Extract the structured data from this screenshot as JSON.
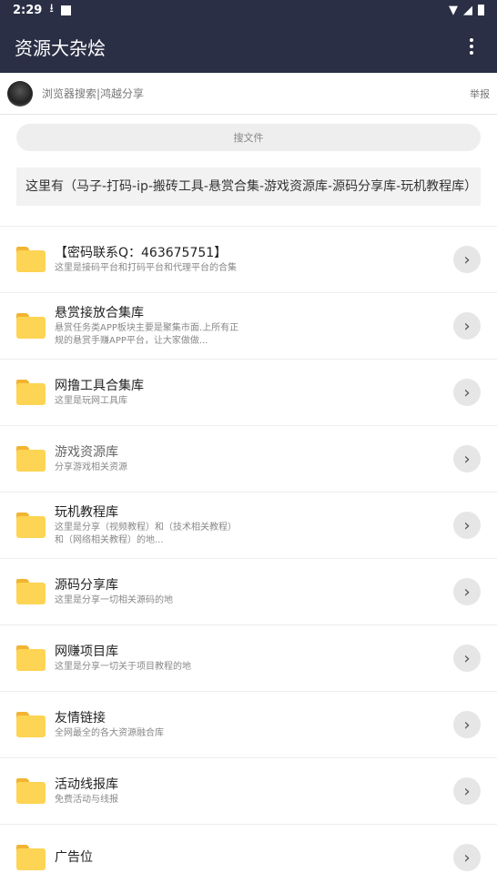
{
  "status": {
    "time": "2:29"
  },
  "appbar": {
    "title": "资源大杂烩"
  },
  "user": {
    "text": "浏览器搜索|鸿越分享",
    "report": "举报"
  },
  "search": {
    "label": "搜文件"
  },
  "description": "这里有（马子-打码-ip-搬砖工具-悬赏合集-游戏资源库-源码分享库-玩机教程库）",
  "items": [
    {
      "name": "【密码联系Q：463675751】",
      "sub": "这里是接码平台和打码平台和代理平台的合集",
      "sub2": ""
    },
    {
      "name": "悬赏接放合集库",
      "sub": "悬赏任务类APP板块主要是聚集市面.上所有正",
      "sub2": "规的悬赏手赚APP平台，让大家做做..."
    },
    {
      "name": "网撸工具合集库",
      "sub": "这里是玩网工具库",
      "sub2": ""
    },
    {
      "name": "游戏资源库",
      "sub": "分享游戏相关资源",
      "sub2": ""
    },
    {
      "name": "玩机教程库",
      "sub": "这里是分享（视频教程）和（技术相关教程）",
      "sub2": "和（网络相关教程）的地..."
    },
    {
      "name": "源码分享库",
      "sub": "这里是分享一切相关源码的地",
      "sub2": ""
    },
    {
      "name": "网赚项目库",
      "sub": "这里是分享一切关于项目教程的地",
      "sub2": ""
    },
    {
      "name": "友情链接",
      "sub": "全网最全的各大资源融合库",
      "sub2": ""
    },
    {
      "name": "活动线报库",
      "sub": "免费活动与线报",
      "sub2": ""
    },
    {
      "name": "广告位",
      "sub": "",
      "sub2": ""
    }
  ]
}
